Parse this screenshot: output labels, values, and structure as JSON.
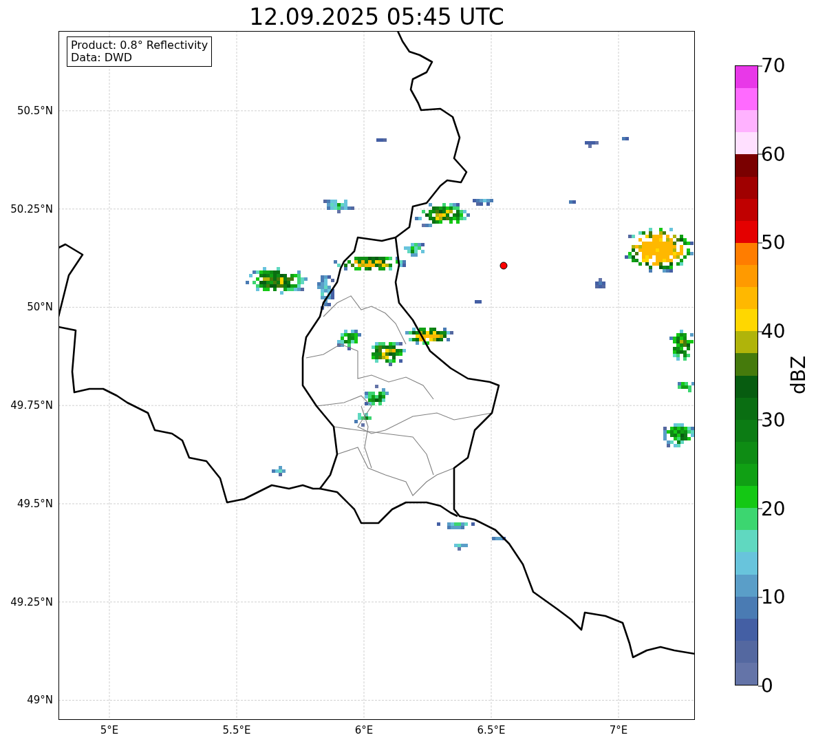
{
  "title": "12.09.2025 05:45 UTC",
  "info_box": [
    "Product: 0.8° Reflectivity",
    "Data: DWD"
  ],
  "map": {
    "lon_ticks": [
      "5°E",
      "5.5°E",
      "6°E",
      "6.5°E",
      "7°E"
    ],
    "lat_ticks": [
      "50.5°N",
      "50.25°N",
      "50°N",
      "49.75°N",
      "49.5°N",
      "49.25°N",
      "49°N"
    ]
  },
  "colorbar": {
    "label": "dBZ",
    "ticks": [
      "70",
      "60",
      "50",
      "40",
      "30",
      "20",
      "10",
      "0"
    ],
    "bins": [
      {
        "color": "#6474a8"
      },
      {
        "color": "#5468a0"
      },
      {
        "color": "#445fa4"
      },
      {
        "color": "#4a7bb3"
      },
      {
        "color": "#5a9ec8"
      },
      {
        "color": "#68c4dc"
      },
      {
        "color": "#60d8c0"
      },
      {
        "color": "#3cd670"
      },
      {
        "color": "#14c814"
      },
      {
        "color": "#10a014"
      },
      {
        "color": "#0e8c14"
      },
      {
        "color": "#0c7c14"
      },
      {
        "color": "#0a6e12"
      },
      {
        "color": "#075c10"
      },
      {
        "color": "#457a0c"
      },
      {
        "color": "#b0b40a"
      },
      {
        "color": "#ffd700"
      },
      {
        "color": "#ffb800"
      },
      {
        "color": "#ff9a00"
      },
      {
        "color": "#ff7d00"
      },
      {
        "color": "#e40000"
      },
      {
        "color": "#c00000"
      },
      {
        "color": "#a00000"
      },
      {
        "color": "#7a0000"
      },
      {
        "color": "#ffe0ff"
      },
      {
        "color": "#ffb2ff"
      },
      {
        "color": "#ff6aff"
      },
      {
        "color": "#e838e8"
      }
    ]
  }
}
